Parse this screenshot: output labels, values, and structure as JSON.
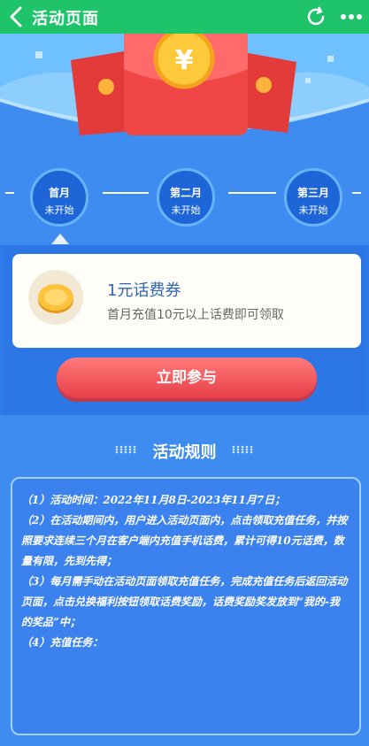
{
  "header": {
    "title": "活动页面"
  },
  "steps": [
    {
      "name": "首月",
      "status": "未开始"
    },
    {
      "name": "第二月",
      "status": "未开始"
    },
    {
      "name": "第三月",
      "status": "未开始"
    }
  ],
  "reward": {
    "title": "1元话费券",
    "description": "首月充值10元以上话费即可领取"
  },
  "action": {
    "join_label": "立即参与"
  },
  "rules": {
    "heading": "活动规则",
    "items": [
      "（1）活动时间：2022年11月8日-2023年11月7日；",
      "（2）在活动期间内，用户进入活动页面内，点击领取充值任务，并按照要求连续三个月在客户端内充值手机话费，累计可得10元话费，数量有限，先到先得；",
      "（3）每月需手动在活动页面领取充值任务，完成充值任务后返回活动页面，点击兑换福利按钮领取话费奖励，话费奖励奖发放到“我的-我的奖品”中；",
      "（4）充值任务："
    ]
  },
  "banner": {
    "coin_symbol": "¥"
  },
  "colors": {
    "topbar": "#1fc46a",
    "background": "#3f8cf0",
    "button": "#e73e48"
  }
}
